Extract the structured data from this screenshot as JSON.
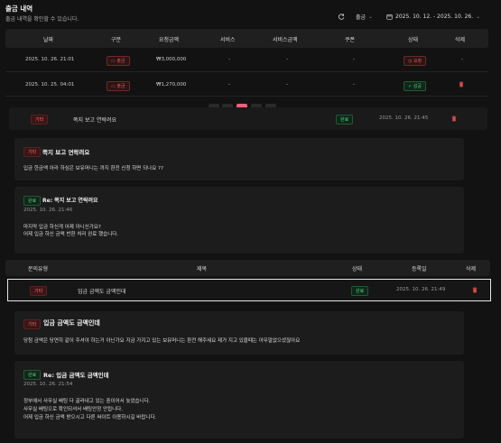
{
  "header": {
    "title": "출금 내역",
    "subtitle": "출금 내역을 확인할 수 있습니다.",
    "filter_label": "출금",
    "date_range": "2025. 10. 12. - 2025. 10. 26."
  },
  "withdraw_table": {
    "columns": [
      "날짜",
      "구분",
      "요청금액",
      "서비스",
      "서비스금액",
      "쿠폰",
      "상태",
      "삭제"
    ],
    "rows": [
      {
        "date": "2025. 10. 26. 21:01",
        "type": "출금",
        "amount": "₩3,000,000",
        "service": "-",
        "service_amount": "-",
        "coupon": "-",
        "status": "요청",
        "delete": "-"
      },
      {
        "date": "2025. 10. 25. 04:01",
        "type": "출금",
        "amount": "₩1,270,000",
        "service": "-",
        "service_amount": "-",
        "coupon": "-",
        "status": "성공",
        "delete": ""
      }
    ]
  },
  "inquiry1": {
    "category": "기타",
    "title": "쪽지 보고 연락려요",
    "status": "완료",
    "date": "2025. 10. 26. 21:45",
    "question_badge": "기타",
    "question_title": "쪽지 보고 연락려요",
    "question_body": "입금 한금액 아라 하심은 보유머니는 까지 환전 신청 하면 되나요 ??",
    "answer_badge": "완료",
    "answer_title": "Re: 쪽지 보고 연락려요",
    "answer_date": "2025. 10. 26. 21:46",
    "answer_line1": "마지막 입금 하신게 어제 아니신가요?",
    "answer_line2": "어제 입금 하신 금액 반환 처리 완료 했습니다."
  },
  "inquiry_table": {
    "columns": [
      "문의유형",
      "제목",
      "상태",
      "등록일",
      "삭제"
    ],
    "row": {
      "category": "기타",
      "title": "입금 금액도 금액인데",
      "status": "완료",
      "date": "2025. 10. 26. 21:49"
    }
  },
  "inquiry2": {
    "question_badge": "기타",
    "question_title": "입금 금액도 금액인데",
    "question_body": "당첨 금액은 당연히 같이 주셔야 하는거 아닌가요 지금 가지고 있는 보유머니는 환전 해주세요 제가 지고 있을때는 아무말없으셨잖아요",
    "answer_badge": "완료",
    "answer_title": "Re: 입금 금액도 금액인데",
    "answer_date": "2025. 10. 26. 21:54",
    "answer_line1": "정부에서 사무실 배팅 다 골라내고 있는 중이어서 늦었습니다.",
    "answer_line2": "사무실 배팅으로 확인되셔서 배팅안정 안됩니다.",
    "answer_line3": "어제 입금 하신 금액 받으시고 다른 싸이트 이용하시길 바랍니다."
  },
  "colors": {
    "accent": "#ff5d7a",
    "green": "#4fd27a",
    "red": "#e05a5a"
  }
}
